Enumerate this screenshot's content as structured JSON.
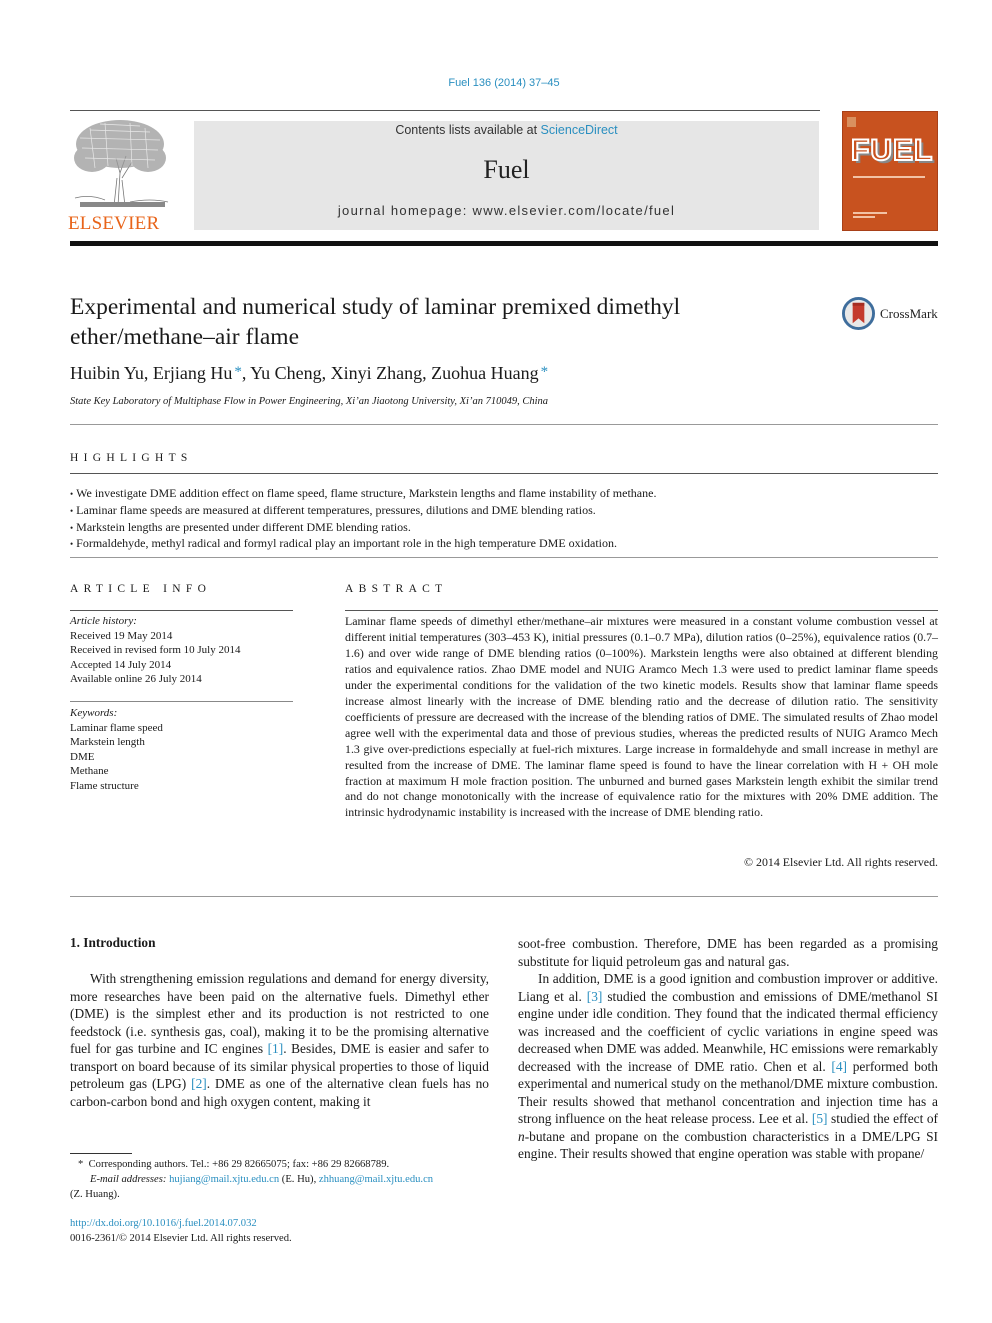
{
  "header": {
    "journal_ref": "Fuel 136 (2014) 37–45",
    "contents_prefix": "Contents lists available at ",
    "contents_link": "ScienceDirect",
    "journal_name": "Fuel",
    "homepage": "journal homepage: www.elsevier.com/locate/fuel",
    "publisher_logo_text": "ELSEVIER",
    "cover_title": "FUEL",
    "crossmark_label": "CrossMark"
  },
  "article": {
    "title": "Experimental and numerical study of laminar premixed dimethyl ether/methane–air flame",
    "authors": [
      {
        "name": "Huibin Yu",
        "corresponding": false
      },
      {
        "name": "Erjiang Hu",
        "corresponding": true
      },
      {
        "name": "Yu Cheng",
        "corresponding": false
      },
      {
        "name": "Xinyi Zhang",
        "corresponding": false
      },
      {
        "name": "Zuohua Huang",
        "corresponding": true
      }
    ],
    "affiliation": "State Key Laboratory of Multiphase Flow in Power Engineering, Xi’an Jiaotong University, Xi’an 710049, China"
  },
  "highlights": {
    "heading": "HIGHLIGHTS",
    "items": [
      "We investigate DME addition effect on flame speed, flame structure, Markstein lengths and flame instability of methane.",
      "Laminar flame speeds are measured at different temperatures, pressures, dilutions and DME blending ratios.",
      "Markstein lengths are presented under different DME blending ratios.",
      "Formaldehyde, methyl radical and formyl radical play an important role in the high temperature DME oxidation."
    ]
  },
  "article_info": {
    "heading": "ARTICLE INFO",
    "history_label": "Article history:",
    "history": [
      "Received 19 May 2014",
      "Received in revised form 10 July 2014",
      "Accepted 14 July 2014",
      "Available online 26 July 2014"
    ],
    "keywords_label": "Keywords:",
    "keywords": [
      "Laminar flame speed",
      "Markstein length",
      "DME",
      "Methane",
      "Flame structure"
    ]
  },
  "abstract": {
    "heading": "ABSTRACT",
    "text": "Laminar flame speeds of dimethyl ether/methane–air mixtures were measured in a constant volume combustion vessel at different initial temperatures (303–453 K), initial pressures (0.1–0.7 MPa), dilution ratios (0–25%), equivalence ratios (0.7–1.6) and over wide range of DME blending ratios (0–100%). Mark­stein lengths were also obtained at different blending ratios and equivalence ratios. Zhao DME model and NUIG Aramco Mech 1.3 were used to predict laminar flame speeds under the experimental conditions for the validation of the two kinetic models. Results show that laminar flame speeds increase almost linearly with the increase of DME blending ratio and the decrease of dilution ratio. The sensitivity coefficients of pressure are decreased with the increase of the blending ratios of DME. The simulated results of Zhao model agree well with the experimental data and those of previous studies, whereas the predicted results of NUIG Aramco Mech 1.3 give over-predictions especially at fuel-rich mixtures. Large increase in form­aldehyde and small increase in methyl are resulted from the increase of DME. The laminar flame speed is found to have the linear correlation with H + OH mole fraction at maximum H mole fraction position. The unburned and burned gases Markstein length exhibit the similar trend and do not change monotonically with the increase of equivalence ratio for the mixtures with 20% DME addition. The intrinsic hydrody­namic instability is increased with the increase of DME blending ratio.",
    "copyright": "© 2014 Elsevier Ltd. All rights reserved."
  },
  "introduction": {
    "heading": "1. Introduction",
    "left_p1_a": "With strengthening emission regulations and demand for energy diversity, more researches have been paid on the alterna­tive fuels. Dimethyl ether (DME) is the simplest ether and its pro­duction is not restricted to one feedstock (i.e. synthesis gas, coal), making it to be the promising alternative fuel for gas turbine and IC engines ",
    "ref1": "[1]",
    "left_p1_b": ". Besides, DME is easier and safer to transport on board because of its similar physical properties to those of liquid petroleum gas (LPG) ",
    "ref2": "[2]",
    "left_p1_c": ". DME as one of the alternative clean fuels has no carbon-carbon bond and high oxygen content, making it",
    "right_p1": "soot-free combustion. Therefore, DME has been regarded as a promising substitute for liquid petroleum gas and natural gas.",
    "right_p2_a": "In addition, DME is a good ignition and combustion improver or additive. Liang et al. ",
    "ref3": "[3]",
    "right_p2_b": " studied the combustion and emissions of DME/methanol SI engine under idle condition. They found that the indicated thermal efficiency was increased and the coefficient of cyclic variations in engine speed was decreased when DME was added. Meanwhile, HC emissions were remarkably decreased with the increase of DME ratio. Chen et al. ",
    "ref4": "[4]",
    "right_p2_c": " performed both experimental and numerical study on the methanol/DME mixture combustion. Their results showed that methanol concentration and injection time has a strong influence on the heat release pro­cess. Lee et al. ",
    "ref5": "[5]",
    "right_p2_d": " studied the effect of ",
    "right_p2_italic": "n",
    "right_p2_e": "-butane and propane on the combustion characteristics in a DME/LPG SI engine. Their results showed that engine operation was stable with propane/"
  },
  "footnote": {
    "star": "*",
    "corresponding": "Corresponding authors. Tel.: +86 29 82665075; fax: +86 29 82668789.",
    "email_label": "E-mail addresses:",
    "email1": "hujiang@mail.xjtu.edu.cn",
    "email1_owner": " (E. Hu), ",
    "email2": "zhhuang@mail.xjtu.edu.cn",
    "email2_owner": "(Z. Huang).",
    "doi": "http://dx.doi.org/10.1016/j.fuel.2014.07.032",
    "issn": "0016-2361/© 2014 Elsevier Ltd. All rights reserved."
  }
}
